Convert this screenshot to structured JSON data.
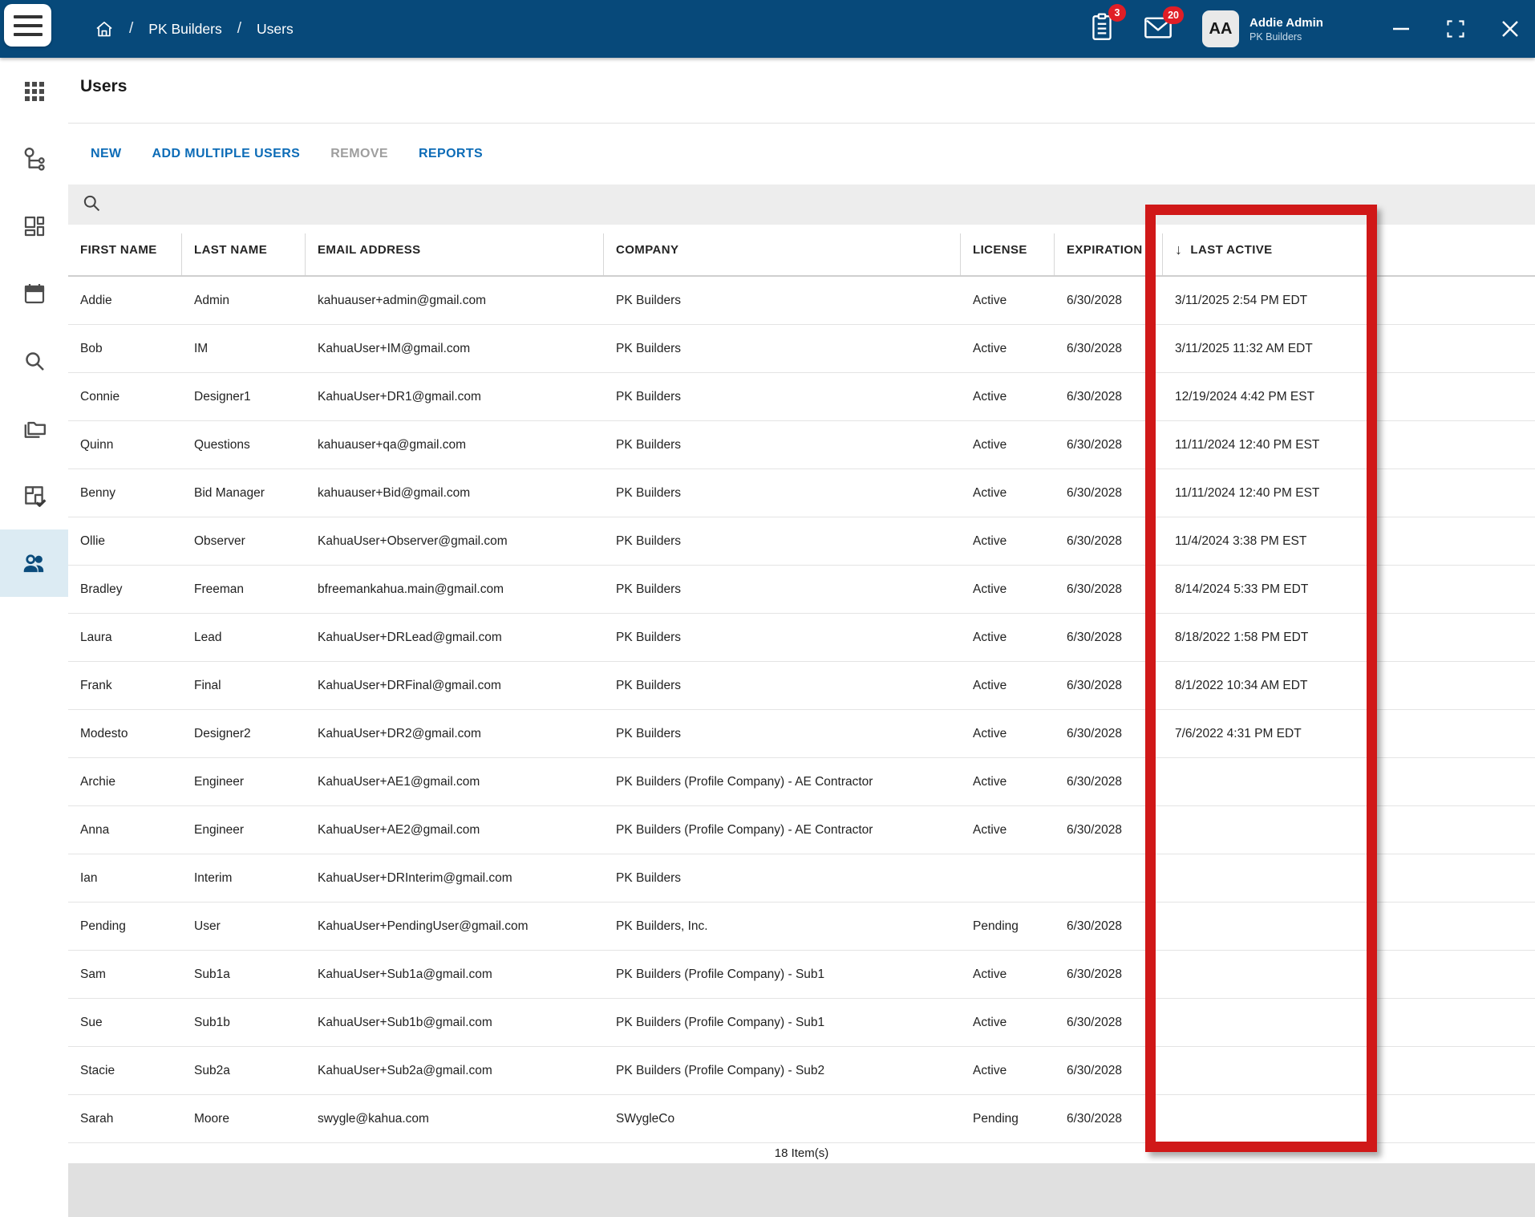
{
  "topbar": {
    "breadcrumb": {
      "separator": "/",
      "project": "PK Builders",
      "page": "Users"
    },
    "tasks_badge": "3",
    "messages_badge": "20",
    "user": {
      "initials": "AA",
      "name": "Addie Admin",
      "company": "PK Builders"
    }
  },
  "sidebar": {
    "items": [
      {
        "name": "sidebar-item-apps",
        "icon": "apps-grid-icon",
        "selected": false
      },
      {
        "name": "sidebar-item-workflow",
        "icon": "workflow-icon",
        "selected": false
      },
      {
        "name": "sidebar-item-dashboard",
        "icon": "dashboard-icon",
        "selected": false
      },
      {
        "name": "sidebar-item-calendar",
        "icon": "calendar-icon",
        "selected": false
      },
      {
        "name": "sidebar-item-search",
        "icon": "search-icon",
        "selected": false
      },
      {
        "name": "sidebar-item-projects",
        "icon": "folders-icon",
        "selected": false
      },
      {
        "name": "sidebar-item-punchlist",
        "icon": "floorplan-check-icon",
        "selected": false
      },
      {
        "name": "sidebar-item-users",
        "icon": "people-icon",
        "selected": true
      }
    ]
  },
  "page": {
    "title": "Users"
  },
  "toolbar": {
    "new": "NEW",
    "add_multiple_users": "ADD MULTIPLE USERS",
    "remove": "REMOVE",
    "reports": "REPORTS"
  },
  "search": {
    "value": ""
  },
  "table": {
    "columns": [
      "FIRST NAME",
      "LAST NAME",
      "EMAIL ADDRESS",
      "COMPANY",
      "LICENSE",
      "EXPIRATION",
      "LAST ACTIVE"
    ],
    "sort": {
      "column_index": 6,
      "direction": "desc",
      "icon": "↓"
    },
    "rows": [
      {
        "first_name": "Addie",
        "last_name": "Admin",
        "email": "kahuauser+admin@gmail.com",
        "company": "PK Builders",
        "license": "Active",
        "expiration": "6/30/2028",
        "last_active": "3/11/2025 2:54 PM EDT"
      },
      {
        "first_name": "Bob",
        "last_name": "IM",
        "email": "KahuaUser+IM@gmail.com",
        "company": "PK Builders",
        "license": "Active",
        "expiration": "6/30/2028",
        "last_active": "3/11/2025 11:32 AM EDT"
      },
      {
        "first_name": "Connie",
        "last_name": "Designer1",
        "email": "KahuaUser+DR1@gmail.com",
        "company": "PK Builders",
        "license": "Active",
        "expiration": "6/30/2028",
        "last_active": "12/19/2024 4:42 PM EST"
      },
      {
        "first_name": "Quinn",
        "last_name": "Questions",
        "email": "kahuauser+qa@gmail.com",
        "company": "PK Builders",
        "license": "Active",
        "expiration": "6/30/2028",
        "last_active": "11/11/2024 12:40 PM EST"
      },
      {
        "first_name": "Benny",
        "last_name": "Bid Manager",
        "email": "kahuauser+Bid@gmail.com",
        "company": "PK Builders",
        "license": "Active",
        "expiration": "6/30/2028",
        "last_active": "11/11/2024 12:40 PM EST"
      },
      {
        "first_name": "Ollie",
        "last_name": "Observer",
        "email": "KahuaUser+Observer@gmail.com",
        "company": "PK Builders",
        "license": "Active",
        "expiration": "6/30/2028",
        "last_active": "11/4/2024 3:38 PM EST"
      },
      {
        "first_name": "Bradley",
        "last_name": "Freeman",
        "email": "bfreemankahua.main@gmail.com",
        "company": "PK Builders",
        "license": "Active",
        "expiration": "6/30/2028",
        "last_active": "8/14/2024 5:33 PM EDT"
      },
      {
        "first_name": "Laura",
        "last_name": "Lead",
        "email": "KahuaUser+DRLead@gmail.com",
        "company": "PK Builders",
        "license": "Active",
        "expiration": "6/30/2028",
        "last_active": "8/18/2022 1:58 PM EDT"
      },
      {
        "first_name": "Frank",
        "last_name": "Final",
        "email": "KahuaUser+DRFinal@gmail.com",
        "company": "PK Builders",
        "license": "Active",
        "expiration": "6/30/2028",
        "last_active": "8/1/2022 10:34 AM EDT"
      },
      {
        "first_name": "Modesto",
        "last_name": "Designer2",
        "email": "KahuaUser+DR2@gmail.com",
        "company": "PK Builders",
        "license": "Active",
        "expiration": "6/30/2028",
        "last_active": "7/6/2022 4:31 PM EDT"
      },
      {
        "first_name": "Archie",
        "last_name": "Engineer",
        "email": "KahuaUser+AE1@gmail.com",
        "company": "PK Builders (Profile Company) - AE Contractor",
        "license": "Active",
        "expiration": "6/30/2028",
        "last_active": ""
      },
      {
        "first_name": "Anna",
        "last_name": "Engineer",
        "email": "KahuaUser+AE2@gmail.com",
        "company": "PK Builders (Profile Company) - AE Contractor",
        "license": "Active",
        "expiration": "6/30/2028",
        "last_active": ""
      },
      {
        "first_name": "Ian",
        "last_name": "Interim",
        "email": "KahuaUser+DRInterim@gmail.com",
        "company": "PK Builders",
        "license": "",
        "expiration": "",
        "last_active": ""
      },
      {
        "first_name": "Pending",
        "last_name": "User",
        "email": "KahuaUser+PendingUser@gmail.com",
        "company": "PK Builders, Inc.",
        "license": "Pending",
        "expiration": "6/30/2028",
        "last_active": ""
      },
      {
        "first_name": "Sam",
        "last_name": "Sub1a",
        "email": "KahuaUser+Sub1a@gmail.com",
        "company": "PK Builders (Profile Company) - Sub1",
        "license": "Active",
        "expiration": "6/30/2028",
        "last_active": ""
      },
      {
        "first_name": "Sue",
        "last_name": "Sub1b",
        "email": "KahuaUser+Sub1b@gmail.com",
        "company": "PK Builders (Profile Company) - Sub1",
        "license": "Active",
        "expiration": "6/30/2028",
        "last_active": ""
      },
      {
        "first_name": "Stacie",
        "last_name": "Sub2a",
        "email": "KahuaUser+Sub2a@gmail.com",
        "company": "PK Builders (Profile Company) - Sub2",
        "license": "Active",
        "expiration": "6/30/2028",
        "last_active": ""
      },
      {
        "first_name": "Sarah",
        "last_name": "Moore",
        "email": "swygle@kahua.com",
        "company": "SWygleCo",
        "license": "Pending",
        "expiration": "6/30/2028",
        "last_active": ""
      }
    ],
    "footer": "18 Item(s)"
  },
  "annotation": {
    "color": "#d01818"
  },
  "colors": {
    "topbar_blue": "#07497a",
    "link_blue": "#0d6cb7",
    "disabled_gray": "#9e9e9e",
    "badge_red": "#e01e26",
    "selected_item_bg": "#dcebf3",
    "annotation_red": "#d01818"
  }
}
